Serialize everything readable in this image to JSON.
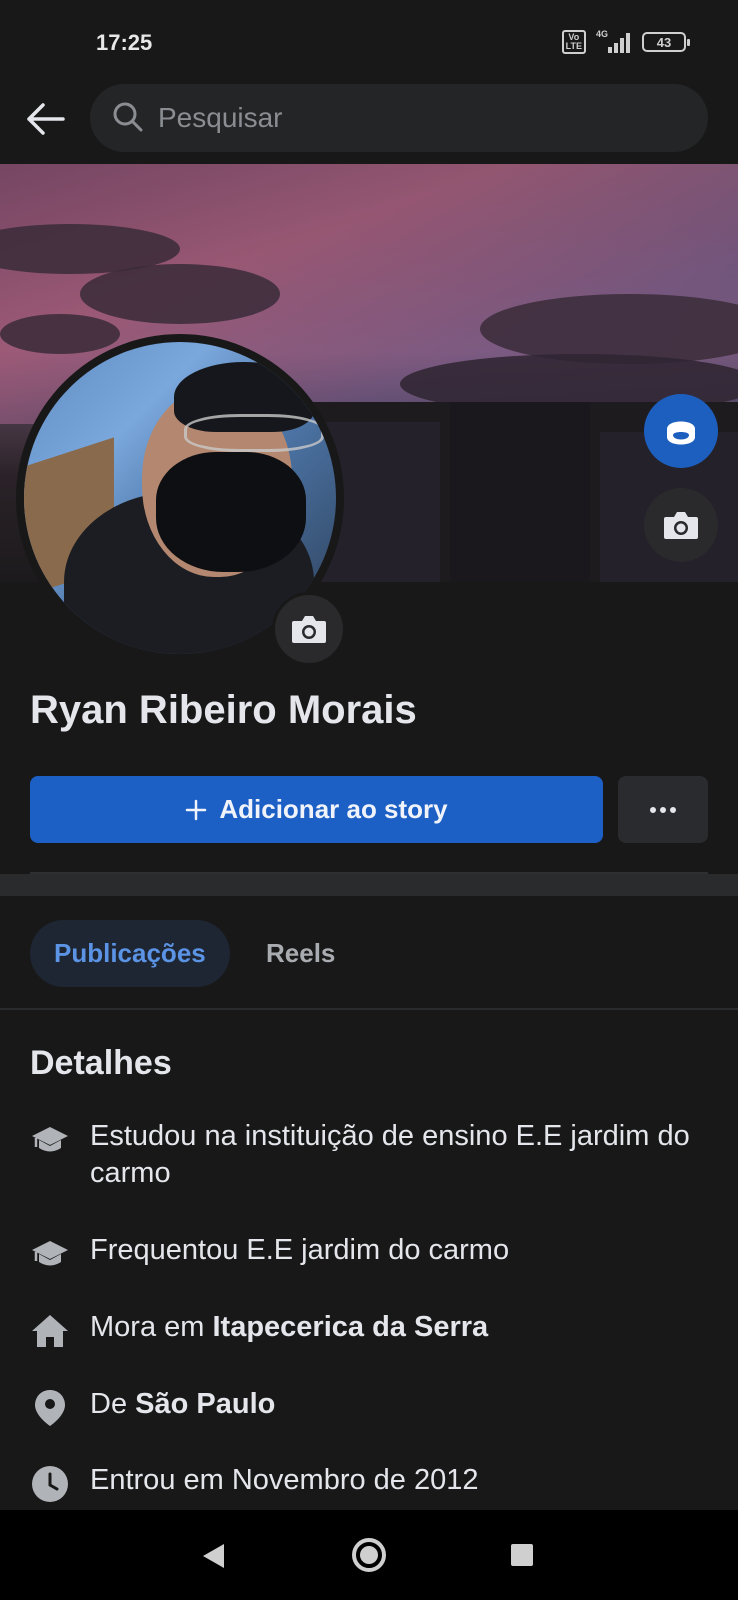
{
  "status_bar": {
    "time": "17:25",
    "volte": "Vo\nLTE",
    "network": "4G",
    "battery": "43"
  },
  "header": {
    "back_icon": "arrow-left-icon",
    "search_placeholder": "Pesquisar",
    "search_icon": "search-icon"
  },
  "profile": {
    "name": "Ryan Ribeiro Morais"
  },
  "actions": {
    "add_story_label": "Adicionar ao story",
    "more_icon": "more-icon"
  },
  "tabs": [
    {
      "label": "Publicações",
      "active": true
    },
    {
      "label": "Reels",
      "active": false
    }
  ],
  "details": {
    "title": "Detalhes",
    "items": [
      {
        "icon": "education-icon",
        "prefix": "Estudou na instituição de ensino E.E jardim do carmo",
        "bold": ""
      },
      {
        "icon": "education-icon",
        "prefix": "Frequentou E.E jardim do carmo",
        "bold": ""
      },
      {
        "icon": "home-icon",
        "prefix": "Mora em ",
        "bold": "Itapecerica da Serra"
      },
      {
        "icon": "location-pin-icon",
        "prefix": "De ",
        "bold": "São Paulo"
      },
      {
        "icon": "clock-icon",
        "prefix": "Entrou em Novembro de 2012",
        "bold": ""
      }
    ]
  },
  "colors": {
    "background": "#181818",
    "accent": "#1c5fc5",
    "tab_active_text": "#5b93e5"
  }
}
